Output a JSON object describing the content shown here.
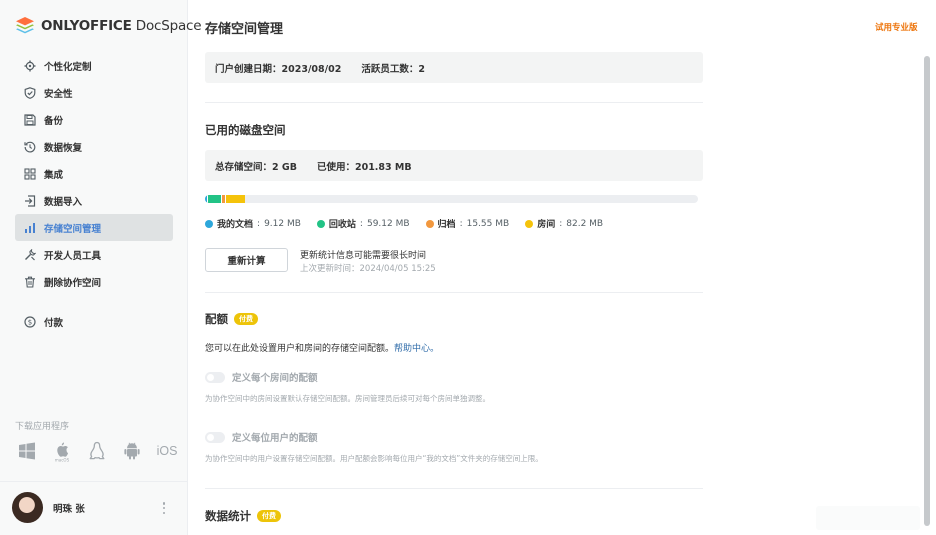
{
  "sidebar": {
    "logo": {
      "brand_bold": "ONLYOFFICE",
      "brand_light": " DocSpace"
    },
    "items": [
      {
        "label": "个性化定制",
        "icon": "gear-icon"
      },
      {
        "label": "安全性",
        "icon": "shield-icon"
      },
      {
        "label": "备份",
        "icon": "floppy-icon"
      },
      {
        "label": "数据恢复",
        "icon": "restore-icon"
      },
      {
        "label": "集成",
        "icon": "grid-icon"
      },
      {
        "label": "数据导入",
        "icon": "import-icon"
      },
      {
        "label": "存储空间管理",
        "icon": "bar-chart-icon",
        "active": true
      },
      {
        "label": "开发人员工具",
        "icon": "developer-tools-icon"
      },
      {
        "label": "删除协作空间",
        "icon": "trash-icon"
      },
      {
        "label": "付款",
        "icon": "payment-icon"
      }
    ],
    "download_title": "下载应用程序",
    "platforms": [
      "windows-icon",
      "macos-icon",
      "linux-icon",
      "android-icon",
      "iOS"
    ],
    "user_name": "明珠 张"
  },
  "header": {
    "title": "存储空间管理",
    "trial_link": "试用专业版"
  },
  "portal_info": {
    "created": "门户创建日期：2023/08/02",
    "active_users": "活跃员工数：2"
  },
  "disk_space": {
    "title": "已用的磁盘空间",
    "total": "总存储空间：2 GB",
    "used": "已使用：201.83 MB",
    "total_mb": 2048,
    "categories": [
      {
        "label": "我的文档",
        "value": "9.12 MB",
        "mb": 9.12,
        "color": "#2da7db"
      },
      {
        "label": "回收站",
        "value": "59.12 MB",
        "mb": 59.12,
        "color": "#22c386"
      },
      {
        "label": "归档",
        "value": "15.55 MB",
        "mb": 15.55,
        "color": "#f2983e"
      },
      {
        "label": "房间",
        "value": "82.2 MB",
        "mb": 82.2,
        "color": "#f5c30b"
      }
    ],
    "recalculate_label": "重新计算",
    "recalc_note": "更新统计信息可能需要很长时间",
    "last_update": "上次更新时间：2024/04/05 15:25"
  },
  "quota": {
    "title": "配额",
    "badge": "付费",
    "description": "您可以在此处设置用户和房间的存储空间配额。",
    "help_link": "帮助中心。",
    "room_quota": {
      "label": "定义每个房间的配额",
      "description": "为协作空间中的房间设置默认存储空间配额。房间管理员后续可对每个房间单独调整。",
      "enabled": false
    },
    "user_quota": {
      "label": "定义每位用户的配额",
      "description": "为协作空间中的用户设置存储空间配额。用户配额会影响每位用户“我的文档”文件夹的存储空间上限。",
      "enabled": false
    }
  },
  "statistics": {
    "title": "数据统计",
    "badge": "付费"
  }
}
